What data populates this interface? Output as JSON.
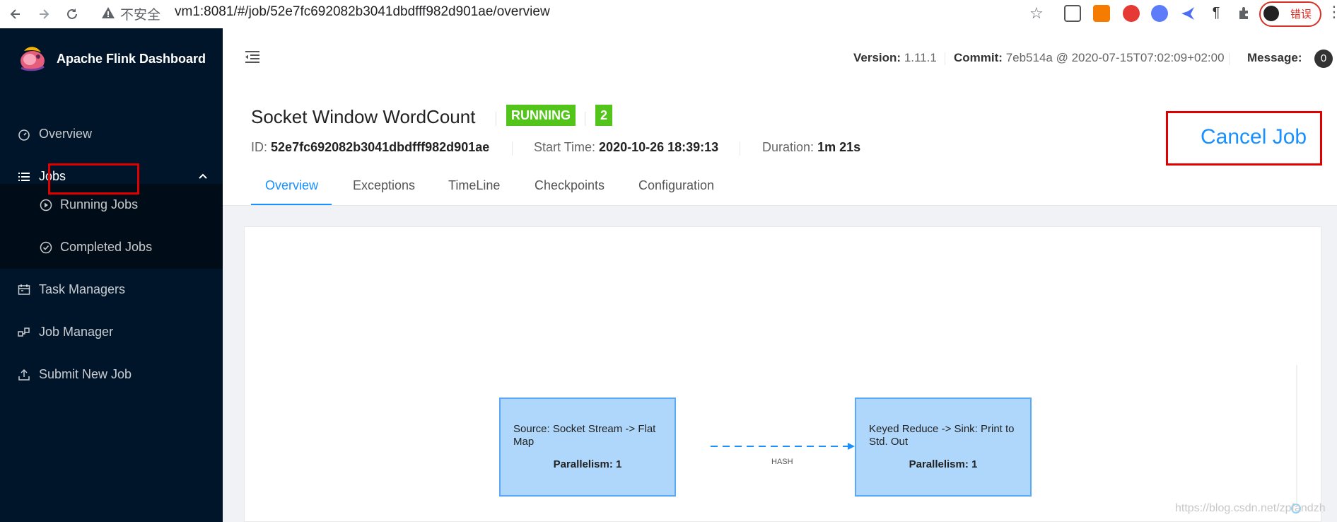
{
  "browser": {
    "insecure_label": "不安全",
    "url": "vm1:8081/#/job/52e7fc692082b3041dbdfff982d901ae/overview",
    "profile_label": "错误"
  },
  "sidebar": {
    "title": "Apache Flink Dashboard",
    "items": [
      {
        "label": "Overview"
      },
      {
        "label": "Jobs"
      },
      {
        "label": "Running Jobs"
      },
      {
        "label": "Completed Jobs"
      },
      {
        "label": "Task Managers"
      },
      {
        "label": "Job Manager"
      },
      {
        "label": "Submit New Job"
      }
    ]
  },
  "header": {
    "version_label": "Version:",
    "version_value": "1.11.1",
    "commit_label": "Commit:",
    "commit_value": "7eb514a @ 2020-07-15T07:02:09+02:00",
    "message_label": "Message:",
    "message_count": "0"
  },
  "job": {
    "name": "Socket Window WordCount",
    "status": "RUNNING",
    "count": "2",
    "id_label": "ID:",
    "id_value": "52e7fc692082b3041dbdfff982d901ae",
    "start_label": "Start Time:",
    "start_value": "2020-10-26 18:39:13",
    "duration_label": "Duration:",
    "duration_value": "1m 21s",
    "cancel_label": "Cancel Job",
    "tabs": [
      {
        "label": "Overview"
      },
      {
        "label": "Exceptions"
      },
      {
        "label": "TimeLine"
      },
      {
        "label": "Checkpoints"
      },
      {
        "label": "Configuration"
      }
    ]
  },
  "graph": {
    "nodes": [
      {
        "name": "Source: Socket Stream -> Flat Map",
        "parallelism": "Parallelism: 1"
      },
      {
        "name": "Keyed Reduce -> Sink: Print to Std. Out",
        "parallelism": "Parallelism: 1"
      }
    ],
    "edge_label": "HASH"
  },
  "watermark": "https://blog.csdn.net/zpfandzh",
  "colors": {
    "sidebar_bg": "#001529",
    "accent": "#1890ff",
    "status_green": "#52c41a",
    "annotation_red": "#e00000"
  }
}
